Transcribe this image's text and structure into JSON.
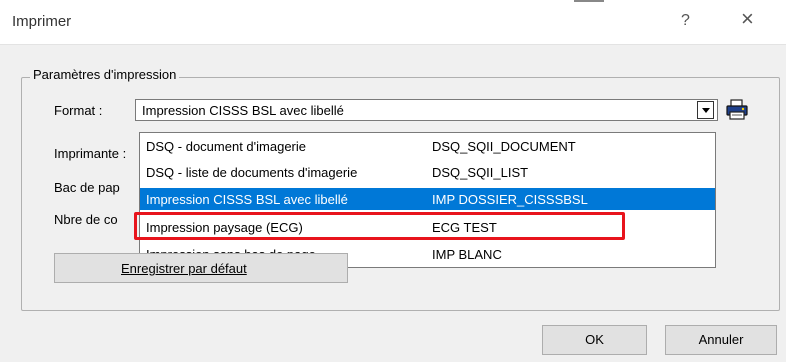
{
  "window": {
    "title": "Imprimer",
    "help_label": "?",
    "close_label": "×"
  },
  "group": {
    "legend": "Paramètres d'impression"
  },
  "fields": {
    "format_label": "Format :",
    "printer_label": "Imprimante :",
    "tray_label": "Bac de pap",
    "copies_label": "Nbre de co"
  },
  "format_combo": {
    "value": "Impression CISSS BSL avec libellé"
  },
  "dropdown": {
    "items": [
      {
        "name": "DSQ - document d'imagerie",
        "code": "DSQ_SQII_DOCUMENT",
        "selected": false
      },
      {
        "name": "DSQ - liste de documents d'imagerie",
        "code": "DSQ_SQII_LIST",
        "selected": false
      },
      {
        "name": "Impression CISSS BSL avec libellé",
        "code": "IMP DOSSIER_CISSSBSL",
        "selected": true
      },
      {
        "name": "Impression paysage (ECG)",
        "code": "ECG TEST",
        "selected": false,
        "annotated": true
      },
      {
        "name": "Impression sans bas de page",
        "code": "IMP BLANC",
        "selected": false
      }
    ]
  },
  "buttons": {
    "save_default": "Enregistrer par défaut",
    "ok": "OK",
    "cancel": "Annuler"
  },
  "colors": {
    "selection": "#0078d7",
    "annotation": "#e8141c",
    "dialog_bg": "#f0f0f0"
  },
  "icons": {
    "printer": "printer-icon",
    "dropdown_arrow": "chevron-down-icon"
  }
}
